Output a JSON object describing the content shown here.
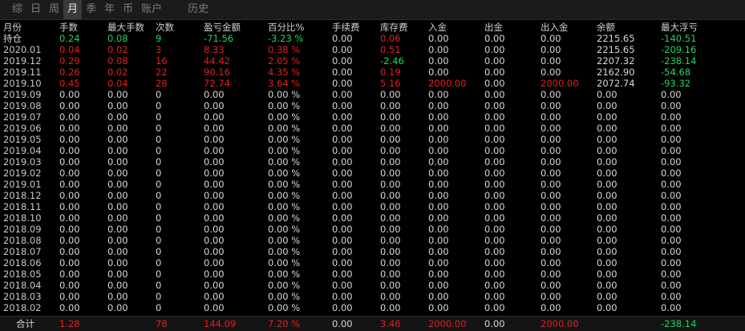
{
  "tabs": [
    {
      "label": "综",
      "active": false
    },
    {
      "label": "日",
      "active": false
    },
    {
      "label": "周",
      "active": false
    },
    {
      "label": "月",
      "active": true
    },
    {
      "label": "季",
      "active": false
    },
    {
      "label": "年",
      "active": false
    },
    {
      "label": "币",
      "active": false
    },
    {
      "label": "账户",
      "active": false
    },
    {
      "label": "历史",
      "active": false,
      "gap": true
    }
  ],
  "colors": {
    "red": "#e02020",
    "green": "#1ed760",
    "white": "#d8d8d8",
    "grey": "#c8c8c8"
  },
  "columns": [
    "月份",
    "手数",
    "最大手数",
    "次数",
    "盈亏金额",
    "百分比%",
    "手续费",
    "库存费",
    "入金",
    "出金",
    "出入金",
    "余额",
    "最大浮亏"
  ],
  "rows": [
    {
      "cells": [
        "持仓",
        "0.24",
        "0.08",
        "9",
        "-71.56",
        "-3.23 %",
        "0.00",
        "0.06",
        "0.00",
        "0.00",
        "0.00",
        "2215.65",
        "-140.51"
      ],
      "colors": [
        "white",
        "green",
        "green",
        "green",
        "green",
        "green",
        "white",
        "red",
        "white",
        "white",
        "white",
        "white",
        "green"
      ]
    },
    {
      "cells": [
        "2020.01",
        "0.04",
        "0.02",
        "3",
        "8.33",
        "0.38 %",
        "0.00",
        "0.51",
        "0.00",
        "0.00",
        "0.00",
        "2215.65",
        "-209.16"
      ],
      "colors": [
        "grey",
        "red",
        "red",
        "red",
        "red",
        "red",
        "white",
        "red",
        "white",
        "white",
        "white",
        "white",
        "green"
      ]
    },
    {
      "cells": [
        "2019.12",
        "0.29",
        "0.08",
        "16",
        "44.42",
        "2.05 %",
        "0.00",
        "-2.46",
        "0.00",
        "0.00",
        "0.00",
        "2207.32",
        "-238.14"
      ],
      "colors": [
        "grey",
        "red",
        "red",
        "red",
        "red",
        "red",
        "white",
        "green",
        "white",
        "white",
        "white",
        "white",
        "green"
      ]
    },
    {
      "cells": [
        "2019.11",
        "0.26",
        "0.02",
        "22",
        "90.16",
        "4.35 %",
        "0.00",
        "0.19",
        "0.00",
        "0.00",
        "0.00",
        "2162.90",
        "-54.68"
      ],
      "colors": [
        "grey",
        "red",
        "red",
        "red",
        "red",
        "red",
        "white",
        "red",
        "white",
        "white",
        "white",
        "white",
        "green"
      ]
    },
    {
      "cells": [
        "2019.10",
        "0.45",
        "0.04",
        "28",
        "72.74",
        "3.64 %",
        "0.00",
        "5.16",
        "2000.00",
        "0.00",
        "2000.00",
        "2072.74",
        "-93.32"
      ],
      "colors": [
        "grey",
        "red",
        "red",
        "red",
        "red",
        "red",
        "white",
        "red",
        "red",
        "white",
        "red",
        "white",
        "green"
      ]
    },
    {
      "cells": [
        "2019.09",
        "0.00",
        "0.00",
        "0",
        "0.00",
        "0.00 %",
        "0.00",
        "0.00",
        "0.00",
        "0.00",
        "0.00",
        "0.00",
        "0.00"
      ]
    },
    {
      "cells": [
        "2019.08",
        "0.00",
        "0.00",
        "0",
        "0.00",
        "0.00 %",
        "0.00",
        "0.00",
        "0.00",
        "0.00",
        "0.00",
        "0.00",
        "0.00"
      ]
    },
    {
      "cells": [
        "2019.07",
        "0.00",
        "0.00",
        "0",
        "0.00",
        "0.00 %",
        "0.00",
        "0.00",
        "0.00",
        "0.00",
        "0.00",
        "0.00",
        "0.00"
      ]
    },
    {
      "cells": [
        "2019.06",
        "0.00",
        "0.00",
        "0",
        "0.00",
        "0.00 %",
        "0.00",
        "0.00",
        "0.00",
        "0.00",
        "0.00",
        "0.00",
        "0.00"
      ]
    },
    {
      "cells": [
        "2019.05",
        "0.00",
        "0.00",
        "0",
        "0.00",
        "0.00 %",
        "0.00",
        "0.00",
        "0.00",
        "0.00",
        "0.00",
        "0.00",
        "0.00"
      ]
    },
    {
      "cells": [
        "2019.04",
        "0.00",
        "0.00",
        "0",
        "0.00",
        "0.00 %",
        "0.00",
        "0.00",
        "0.00",
        "0.00",
        "0.00",
        "0.00",
        "0.00"
      ]
    },
    {
      "cells": [
        "2019.03",
        "0.00",
        "0.00",
        "0",
        "0.00",
        "0.00 %",
        "0.00",
        "0.00",
        "0.00",
        "0.00",
        "0.00",
        "0.00",
        "0.00"
      ]
    },
    {
      "cells": [
        "2019.02",
        "0.00",
        "0.00",
        "0",
        "0.00",
        "0.00 %",
        "0.00",
        "0.00",
        "0.00",
        "0.00",
        "0.00",
        "0.00",
        "0.00"
      ]
    },
    {
      "cells": [
        "2019.01",
        "0.00",
        "0.00",
        "0",
        "0.00",
        "0.00 %",
        "0.00",
        "0.00",
        "0.00",
        "0.00",
        "0.00",
        "0.00",
        "0.00"
      ]
    },
    {
      "cells": [
        "2018.12",
        "0.00",
        "0.00",
        "0",
        "0.00",
        "0.00 %",
        "0.00",
        "0.00",
        "0.00",
        "0.00",
        "0.00",
        "0.00",
        "0.00"
      ]
    },
    {
      "cells": [
        "2018.11",
        "0.00",
        "0.00",
        "0",
        "0.00",
        "0.00 %",
        "0.00",
        "0.00",
        "0.00",
        "0.00",
        "0.00",
        "0.00",
        "0.00"
      ]
    },
    {
      "cells": [
        "2018.10",
        "0.00",
        "0.00",
        "0",
        "0.00",
        "0.00 %",
        "0.00",
        "0.00",
        "0.00",
        "0.00",
        "0.00",
        "0.00",
        "0.00"
      ]
    },
    {
      "cells": [
        "2018.09",
        "0.00",
        "0.00",
        "0",
        "0.00",
        "0.00 %",
        "0.00",
        "0.00",
        "0.00",
        "0.00",
        "0.00",
        "0.00",
        "0.00"
      ]
    },
    {
      "cells": [
        "2018.08",
        "0.00",
        "0.00",
        "0",
        "0.00",
        "0.00 %",
        "0.00",
        "0.00",
        "0.00",
        "0.00",
        "0.00",
        "0.00",
        "0.00"
      ]
    },
    {
      "cells": [
        "2018.07",
        "0.00",
        "0.00",
        "0",
        "0.00",
        "0.00 %",
        "0.00",
        "0.00",
        "0.00",
        "0.00",
        "0.00",
        "0.00",
        "0.00"
      ]
    },
    {
      "cells": [
        "2018.06",
        "0.00",
        "0.00",
        "0",
        "0.00",
        "0.00 %",
        "0.00",
        "0.00",
        "0.00",
        "0.00",
        "0.00",
        "0.00",
        "0.00"
      ]
    },
    {
      "cells": [
        "2018.05",
        "0.00",
        "0.00",
        "0",
        "0.00",
        "0.00 %",
        "0.00",
        "0.00",
        "0.00",
        "0.00",
        "0.00",
        "0.00",
        "0.00"
      ]
    },
    {
      "cells": [
        "2018.04",
        "0.00",
        "0.00",
        "0",
        "0.00",
        "0.00 %",
        "0.00",
        "0.00",
        "0.00",
        "0.00",
        "0.00",
        "0.00",
        "0.00"
      ]
    },
    {
      "cells": [
        "2018.03",
        "0.00",
        "0.00",
        "0",
        "0.00",
        "0.00 %",
        "0.00",
        "0.00",
        "0.00",
        "0.00",
        "0.00",
        "0.00",
        "0.00"
      ]
    },
    {
      "cells": [
        "2018.02",
        "0.00",
        "0.00",
        "0",
        "0.00",
        "0.00 %",
        "0.00",
        "0.00",
        "0.00",
        "0.00",
        "0.00",
        "0.00",
        "0.00"
      ]
    }
  ],
  "footer": {
    "cells": [
      "合计",
      "1.28",
      "",
      "78",
      "144.09",
      "7.20 %",
      "0.00",
      "3.46",
      "2000.00",
      "0.00",
      "2000.00",
      "",
      "-238.14"
    ],
    "colors": [
      "white",
      "red",
      "red",
      "red",
      "red",
      "red",
      "white",
      "red",
      "red",
      "white",
      "red",
      "white",
      "green"
    ]
  }
}
